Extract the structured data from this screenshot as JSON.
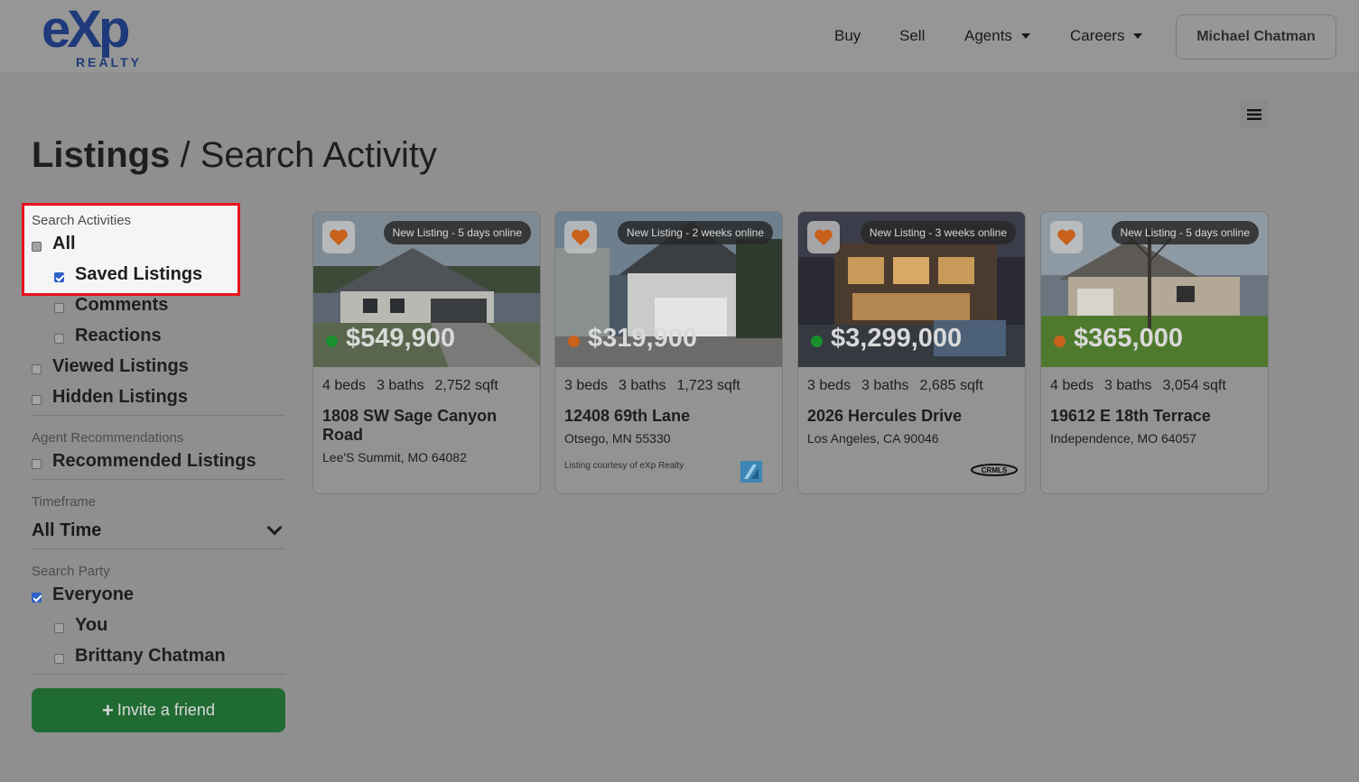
{
  "header": {
    "logo_main": "eXp",
    "logo_sub": "REALTY",
    "nav": {
      "buy": "Buy",
      "sell": "Sell",
      "agents": "Agents",
      "careers": "Careers"
    },
    "user_name": "Michael Chatman"
  },
  "page": {
    "title_strong": "Listings",
    "title_sep": " / ",
    "title_rest": "Search Activity"
  },
  "sidebar": {
    "search_activities": {
      "label": "Search Activities",
      "options": [
        {
          "label": "All",
          "checked": false
        },
        {
          "label": "Saved Listings",
          "checked": true
        },
        {
          "label": "Comments",
          "checked": false
        },
        {
          "label": "Reactions",
          "checked": false
        },
        {
          "label": "Viewed Listings",
          "checked": false
        },
        {
          "label": "Hidden Listings",
          "checked": false
        }
      ]
    },
    "agent_recommendations": {
      "label": "Agent Recommendations",
      "options": [
        {
          "label": "Recommended Listings",
          "checked": false
        }
      ]
    },
    "timeframe": {
      "label": "Timeframe",
      "value": "All Time"
    },
    "search_party": {
      "label": "Search Party",
      "options": [
        {
          "label": "Everyone",
          "checked": true
        },
        {
          "label": "You",
          "checked": false
        },
        {
          "label": "Brittany Chatman",
          "checked": false
        }
      ]
    },
    "invite_label": "Invite a friend",
    "invite_plus": "+"
  },
  "listings": [
    {
      "badge": "New Listing - 5 days online",
      "price": "$549,900",
      "status_color": "#1a8f2e",
      "beds": "4 beds",
      "baths": "3 baths",
      "sqft": "2,752 sqft",
      "address": "1808 SW Sage Canyon Road",
      "city": "Lee'S Summit, MO 64082"
    },
    {
      "badge": "New Listing - 2 weeks online",
      "price": "$319,900",
      "status_color": "#c8611c",
      "beds": "3 beds",
      "baths": "3 baths",
      "sqft": "1,723 sqft",
      "address": "12408 69th Lane",
      "city": "Otsego, MN 55330",
      "courtesy": "Listing courtesy of eXp Realty"
    },
    {
      "badge": "New Listing - 3 weeks online",
      "price": "$3,299,000",
      "status_color": "#1a8f2e",
      "beds": "3 beds",
      "baths": "3 baths",
      "sqft": "2,685 sqft",
      "address": "2026 Hercules Drive",
      "city": "Los Angeles, CA 90046",
      "mls_logo": "CRMLS"
    },
    {
      "badge": "New Listing - 5 days online",
      "price": "$365,000",
      "status_color": "#c8611c",
      "beds": "4 beds",
      "baths": "3 baths",
      "sqft": "3,054 sqft",
      "address": "19612 E 18th Terrace",
      "city": "Independence, MO 64057"
    }
  ],
  "colors": {
    "accent_blue": "#1f3a7a",
    "heart": "#c8611c",
    "invite_green": "#206b32",
    "highlight_red": "#e8121b"
  }
}
